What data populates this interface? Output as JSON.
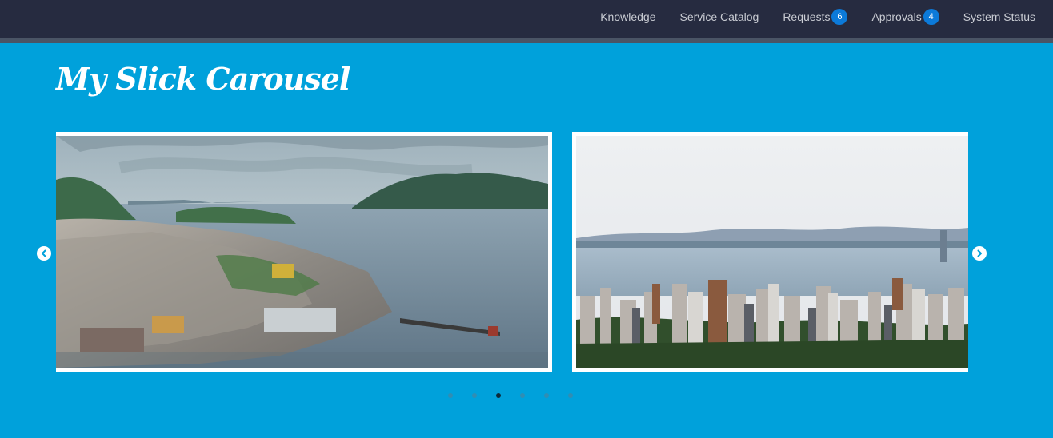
{
  "header": {
    "nav": [
      {
        "label": "Knowledge"
      },
      {
        "label": "Service Catalog"
      },
      {
        "label": "Requests",
        "badge": "6"
      },
      {
        "label": "Approvals",
        "badge": "4"
      },
      {
        "label": "System Status"
      }
    ]
  },
  "main": {
    "title": "My Slick Carousel"
  },
  "carousel": {
    "prev_icon": "chevron-left-circle-icon",
    "next_icon": "chevron-right-circle-icon",
    "slides": [
      {
        "name": "coastal-town-fjord-photo"
      },
      {
        "name": "harbor-city-skyline-photo"
      }
    ],
    "dots": 6,
    "active_dot": 3
  },
  "colors": {
    "background": "#00a1db",
    "header": "#262b40",
    "badge": "#0c7ad9",
    "nav_text": "#c9ccd3"
  }
}
